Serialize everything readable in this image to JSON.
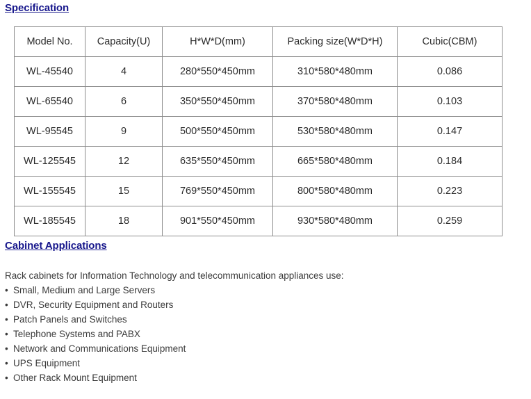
{
  "document": {
    "background_color": "#ffffff",
    "heading_color": "#17178c",
    "body_text_color": "#3a3a3a",
    "table_border_color": "#8c8c8c",
    "table_outer_border_color": "#4a4a4a"
  },
  "specification": {
    "heading": "Specification",
    "table": {
      "columns": [
        "Model No.",
        "Capacity(U)",
        "H*W*D(mm)",
        "Packing size(W*D*H)",
        "Cubic(CBM)"
      ],
      "rows": [
        [
          "WL-45540",
          "4",
          "280*550*450mm",
          "310*580*480mm",
          "0.086"
        ],
        [
          "WL-65540",
          "6",
          "350*550*450mm",
          "370*580*480mm",
          "0.103"
        ],
        [
          "WL-95545",
          "9",
          "500*550*450mm",
          "530*580*480mm",
          "0.147"
        ],
        [
          "WL-125545",
          "12",
          "635*550*450mm",
          "665*580*480mm",
          "0.184"
        ],
        [
          "WL-155545",
          "15",
          "769*550*450mm",
          "800*580*480mm",
          "0.223"
        ],
        [
          "WL-185545",
          "18",
          "901*550*450mm",
          "930*580*480mm",
          "0.259"
        ]
      ]
    }
  },
  "applications": {
    "heading": "Cabinet Applications",
    "intro": "Rack cabinets for Information Technology and telecommunication appliances use:",
    "bullet_glyph": "•",
    "items": [
      "Small, Medium and Large Servers",
      "DVR, Security Equipment and Routers",
      "Patch Panels and Switches",
      "Telephone Systems and PABX",
      "Network and Communications Equipment",
      "UPS Equipment",
      "Other Rack Mount Equipment"
    ]
  }
}
